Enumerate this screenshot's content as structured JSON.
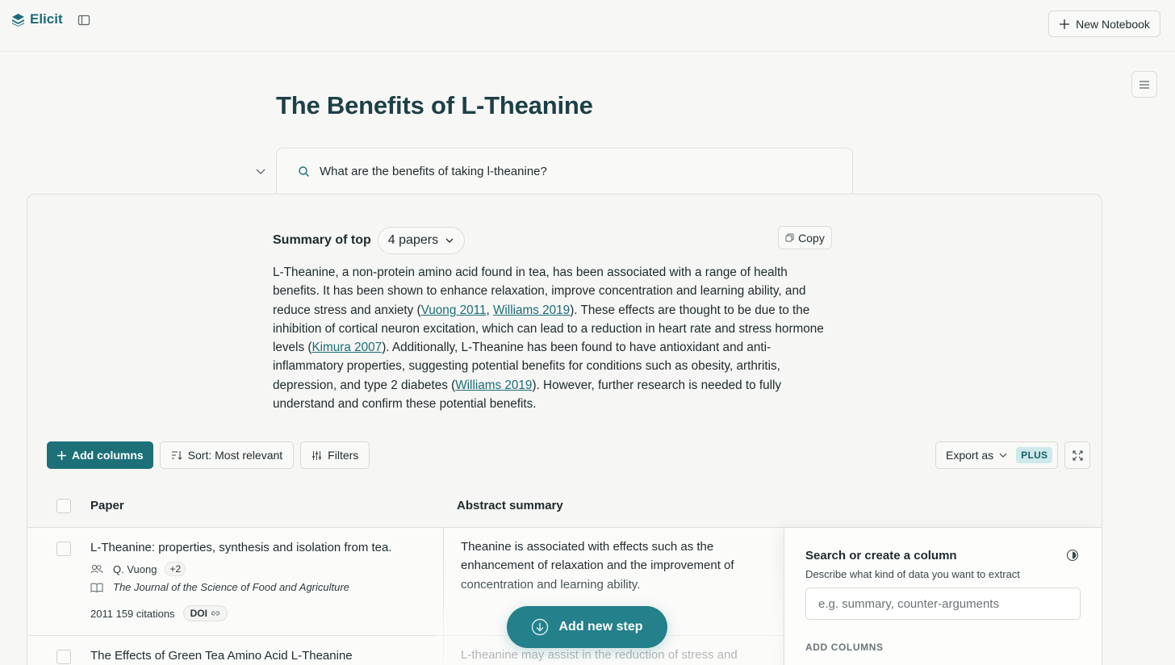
{
  "app": {
    "name": "Elicit"
  },
  "header": {
    "new_notebook_label": "New Notebook"
  },
  "notebook": {
    "title": "The Benefits of L-Theanine"
  },
  "query": {
    "text": "What are the benefits of taking l-theanine?"
  },
  "summary": {
    "label": "Summary of top",
    "papers_selected": "4 papers",
    "copy_label": "Copy",
    "body_parts": {
      "p1": "L-Theanine, a non-protein amino acid found in tea, has been associated with a range of health benefits. It has been shown to enhance relaxation, improve concentration and learning ability, and reduce stress and anxiety (",
      "c1": "Vuong 2011",
      "s1": ", ",
      "c2": "Williams 2019",
      "p2": "). These effects are thought to be due to the inhibition of cortical neuron excitation, which can lead to a reduction in heart rate and stress hormone levels (",
      "c3": "Kimura 2007",
      "p3": "). Additionally, L-Theanine has been found to have antioxidant and anti-inflammatory properties, suggesting potential benefits for conditions such as obesity, arthritis, depression, and type 2 diabetes (",
      "c4": "Williams 2019",
      "p4": "). However, further research is needed to fully understand and confirm these potential benefits."
    }
  },
  "toolbar": {
    "add_columns_label": "Add columns",
    "sort_label": "Sort: Most relevant",
    "filters_label": "Filters",
    "export_label": "Export as",
    "plus_badge": "PLUS"
  },
  "table": {
    "headers": {
      "paper": "Paper",
      "abstract": "Abstract summary"
    },
    "rows": [
      {
        "title": "L-Theanine: properties, synthesis and isolation from tea.",
        "author": "Q. Vuong",
        "extra_authors": "+2",
        "journal": "The Journal of the Science of Food and Agriculture",
        "year_citations": "2011 159 citations",
        "doi_label": "DOI",
        "abstract": "Theanine is associated with effects such as the enhancement of relaxation and the improvement of concentration and learning ability."
      },
      {
        "title": "The Effects of Green Tea Amino Acid L-Theanine",
        "abstract": "L-theanine may assist in the reduction of stress and"
      }
    ]
  },
  "column_panel": {
    "title": "Search or create a column",
    "description": "Describe what kind of data you want to extract",
    "input_placeholder": "e.g. summary, counter-arguments",
    "section_label": "ADD COLUMNS"
  },
  "add_step": {
    "label": "Add new step"
  },
  "colors": {
    "accent": "#1d7078",
    "title": "#1d4047",
    "link": "#1a6d78"
  }
}
